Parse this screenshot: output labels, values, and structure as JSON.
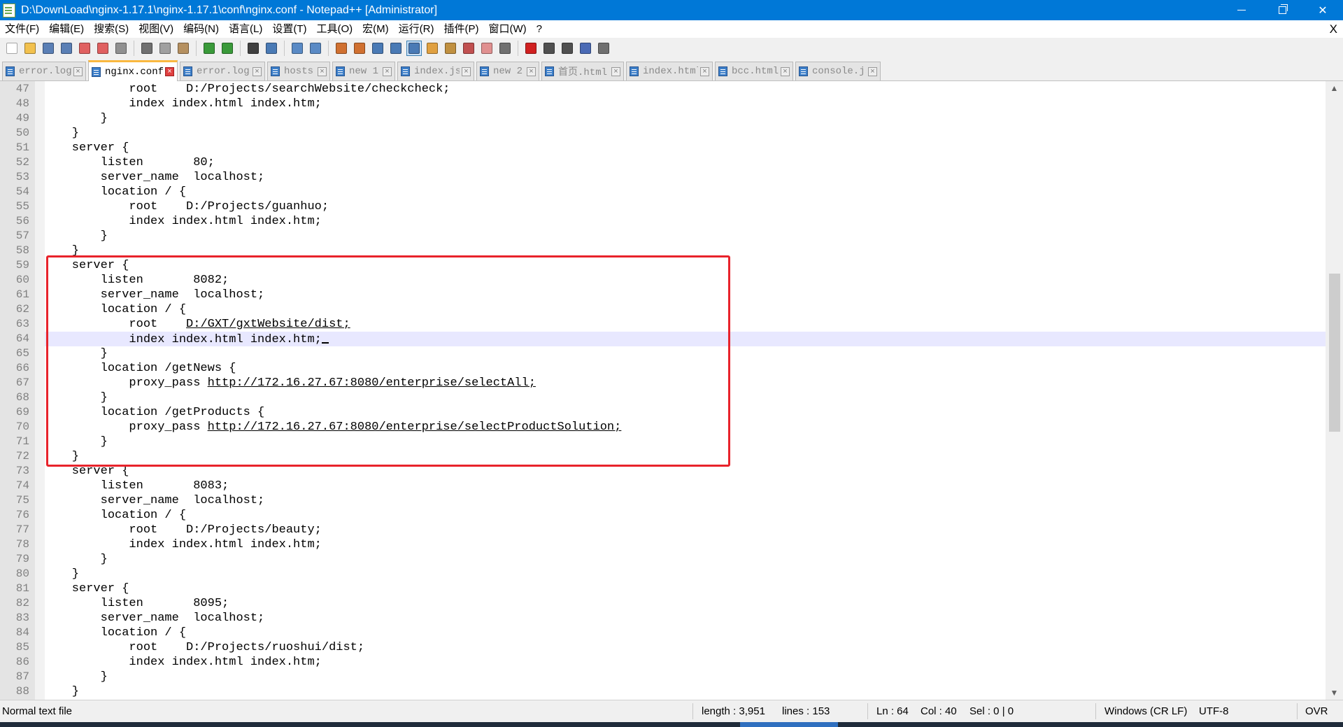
{
  "window": {
    "title": "D:\\DownLoad\\nginx-1.17.1\\nginx-1.17.1\\conf\\nginx.conf - Notepad++ [Administrator]"
  },
  "menu": {
    "items": [
      "文件(F)",
      "编辑(E)",
      "搜索(S)",
      "视图(V)",
      "编码(N)",
      "语言(L)",
      "设置(T)",
      "工具(O)",
      "宏(M)",
      "运行(R)",
      "插件(P)",
      "窗口(W)",
      "?"
    ],
    "close_label": "X"
  },
  "toolbar": {
    "buttons": [
      {
        "icon": "new-file-icon",
        "color": "#ffffff"
      },
      {
        "icon": "open-file-icon",
        "color": "#f2c14e"
      },
      {
        "icon": "save-icon",
        "color": "#5a7fb5"
      },
      {
        "icon": "save-all-icon",
        "color": "#5a7fb5"
      },
      {
        "icon": "close-icon",
        "color": "#e06060"
      },
      {
        "icon": "close-all-icon",
        "color": "#e06060"
      },
      {
        "icon": "print-icon",
        "color": "#909090"
      },
      {
        "sep": true
      },
      {
        "icon": "cut-icon",
        "color": "#707070"
      },
      {
        "icon": "copy-icon",
        "color": "#a0a0a0"
      },
      {
        "icon": "paste-icon",
        "color": "#b59060"
      },
      {
        "sep": true
      },
      {
        "icon": "undo-icon",
        "color": "#3a9a3a"
      },
      {
        "icon": "redo-icon",
        "color": "#3a9a3a"
      },
      {
        "sep": true
      },
      {
        "icon": "find-icon",
        "color": "#404040"
      },
      {
        "icon": "replace-icon",
        "color": "#4a7ab5"
      },
      {
        "sep": true
      },
      {
        "icon": "zoom-in-icon",
        "color": "#5a8ac5"
      },
      {
        "icon": "zoom-out-icon",
        "color": "#5a8ac5"
      },
      {
        "sep": true
      },
      {
        "icon": "sync-vertical-icon",
        "color": "#d07030"
      },
      {
        "icon": "sync-horizontal-icon",
        "color": "#d07030"
      },
      {
        "icon": "word-wrap-icon",
        "color": "#4a7ab5"
      },
      {
        "icon": "show-all-chars-icon",
        "color": "#4a7ab5"
      },
      {
        "icon": "indent-guide-icon",
        "color": "#4a7ab5",
        "active": true
      },
      {
        "icon": "language-icon",
        "color": "#e0a040"
      },
      {
        "icon": "document-map-icon",
        "color": "#c09040"
      },
      {
        "icon": "function-list-icon",
        "color": "#c05050"
      },
      {
        "icon": "folder-workspace-icon",
        "color": "#e09090"
      },
      {
        "icon": "monitoring-icon",
        "color": "#707070"
      },
      {
        "sep": true
      },
      {
        "icon": "record-macro-icon",
        "color": "#d02020"
      },
      {
        "icon": "stop-record-icon",
        "color": "#505050"
      },
      {
        "icon": "play-macro-icon",
        "color": "#505050"
      },
      {
        "icon": "run-macro-multiple-icon",
        "color": "#4a6ab5"
      },
      {
        "icon": "save-macro-icon",
        "color": "#707070"
      }
    ]
  },
  "tabs": [
    {
      "label": "error.log",
      "active": false
    },
    {
      "label": "nginx.conf",
      "active": true
    },
    {
      "label": "error.log",
      "active": false
    },
    {
      "label": "hosts",
      "active": false
    },
    {
      "label": "new 1",
      "active": false
    },
    {
      "label": "index.js",
      "active": false
    },
    {
      "label": "new 2",
      "active": false
    },
    {
      "label": "首页.html",
      "active": false
    },
    {
      "label": "index.html",
      "active": false
    },
    {
      "label": "bcc.html",
      "active": false
    },
    {
      "label": "console.js",
      "active": false
    }
  ],
  "editor": {
    "current_line": 64,
    "lines": [
      {
        "n": "47",
        "segs": [
          {
            "t": "            root    D:/Projects/searchWebsite/checkcheck;"
          }
        ]
      },
      {
        "n": "48",
        "segs": [
          {
            "t": "            index index.html index.htm;"
          }
        ]
      },
      {
        "n": "49",
        "segs": [
          {
            "t": "        }"
          }
        ]
      },
      {
        "n": "50",
        "segs": [
          {
            "t": "    }"
          }
        ]
      },
      {
        "n": "51",
        "segs": [
          {
            "t": "    server {"
          }
        ]
      },
      {
        "n": "52",
        "segs": [
          {
            "t": "        listen       80;"
          }
        ]
      },
      {
        "n": "53",
        "segs": [
          {
            "t": "        server_name  localhost;"
          }
        ]
      },
      {
        "n": "54",
        "segs": [
          {
            "t": "        location / {"
          }
        ]
      },
      {
        "n": "55",
        "segs": [
          {
            "t": "            root    D:/Projects/guanhuo;"
          }
        ]
      },
      {
        "n": "56",
        "segs": [
          {
            "t": "            index index.html index.htm;"
          }
        ]
      },
      {
        "n": "57",
        "segs": [
          {
            "t": "        }"
          }
        ]
      },
      {
        "n": "58",
        "segs": [
          {
            "t": "    }"
          }
        ]
      },
      {
        "n": "59",
        "segs": [
          {
            "t": "    server {"
          }
        ]
      },
      {
        "n": "60",
        "segs": [
          {
            "t": "        listen       8082;"
          }
        ]
      },
      {
        "n": "61",
        "segs": [
          {
            "t": "        server_name  localhost;"
          }
        ]
      },
      {
        "n": "62",
        "segs": [
          {
            "t": "        location / {"
          }
        ]
      },
      {
        "n": "63",
        "segs": [
          {
            "t": "            root    "
          },
          {
            "t": "D:/GXT/gxtWebsite/dist;",
            "u": true
          }
        ]
      },
      {
        "n": "64",
        "segs": [
          {
            "t": "            index index.html index.htm;"
          }
        ],
        "caret": true
      },
      {
        "n": "65",
        "segs": [
          {
            "t": "        }"
          }
        ]
      },
      {
        "n": "66",
        "segs": [
          {
            "t": "        location /getNews {"
          }
        ]
      },
      {
        "n": "67",
        "segs": [
          {
            "t": "            proxy_pass "
          },
          {
            "t": "http://172.16.27.67:8080/enterprise/selectAll;",
            "u": true
          }
        ]
      },
      {
        "n": "68",
        "segs": [
          {
            "t": "        }"
          }
        ]
      },
      {
        "n": "69",
        "segs": [
          {
            "t": "        location /getProducts {"
          }
        ]
      },
      {
        "n": "70",
        "segs": [
          {
            "t": "            proxy_pass "
          },
          {
            "t": "http://172.16.27.67:8080/enterprise/selectProductSolution;",
            "u": true
          }
        ]
      },
      {
        "n": "71",
        "segs": [
          {
            "t": "        }"
          }
        ]
      },
      {
        "n": "72",
        "segs": [
          {
            "t": "    }"
          }
        ]
      },
      {
        "n": "73",
        "segs": [
          {
            "t": "    server {"
          }
        ]
      },
      {
        "n": "74",
        "segs": [
          {
            "t": "        listen       8083;"
          }
        ]
      },
      {
        "n": "75",
        "segs": [
          {
            "t": "        server_name  localhost;"
          }
        ]
      },
      {
        "n": "76",
        "segs": [
          {
            "t": "        location / {"
          }
        ]
      },
      {
        "n": "77",
        "segs": [
          {
            "t": "            root    D:/Projects/beauty;"
          }
        ]
      },
      {
        "n": "78",
        "segs": [
          {
            "t": "            index index.html index.htm;"
          }
        ]
      },
      {
        "n": "79",
        "segs": [
          {
            "t": "        }"
          }
        ]
      },
      {
        "n": "80",
        "segs": [
          {
            "t": "    }"
          }
        ]
      },
      {
        "n": "81",
        "segs": [
          {
            "t": "    server {"
          }
        ]
      },
      {
        "n": "82",
        "segs": [
          {
            "t": "        listen       8095;"
          }
        ]
      },
      {
        "n": "83",
        "segs": [
          {
            "t": "        server_name  localhost;"
          }
        ]
      },
      {
        "n": "84",
        "segs": [
          {
            "t": "        location / {"
          }
        ]
      },
      {
        "n": "85",
        "segs": [
          {
            "t": "            root    D:/Projects/ruoshui/dist;"
          }
        ]
      },
      {
        "n": "86",
        "segs": [
          {
            "t": "            index index.html index.htm;"
          }
        ]
      },
      {
        "n": "87",
        "segs": [
          {
            "t": "        }"
          }
        ]
      },
      {
        "n": "88",
        "segs": [
          {
            "t": "    }"
          }
        ]
      }
    ]
  },
  "status": {
    "file_type": "Normal text file",
    "length": "length : 3,951",
    "lines": "lines : 153",
    "ln": "Ln : 64",
    "col": "Col : 40",
    "sel": "Sel : 0 | 0",
    "eol": "Windows (CR LF)",
    "encoding": "UTF-8",
    "mode": "OVR"
  },
  "colors": {
    "titlebar": "#0078d7",
    "highlight_box": "#e8232b",
    "current_line": "#e8e8ff",
    "active_tab_accent": "#fab840"
  }
}
